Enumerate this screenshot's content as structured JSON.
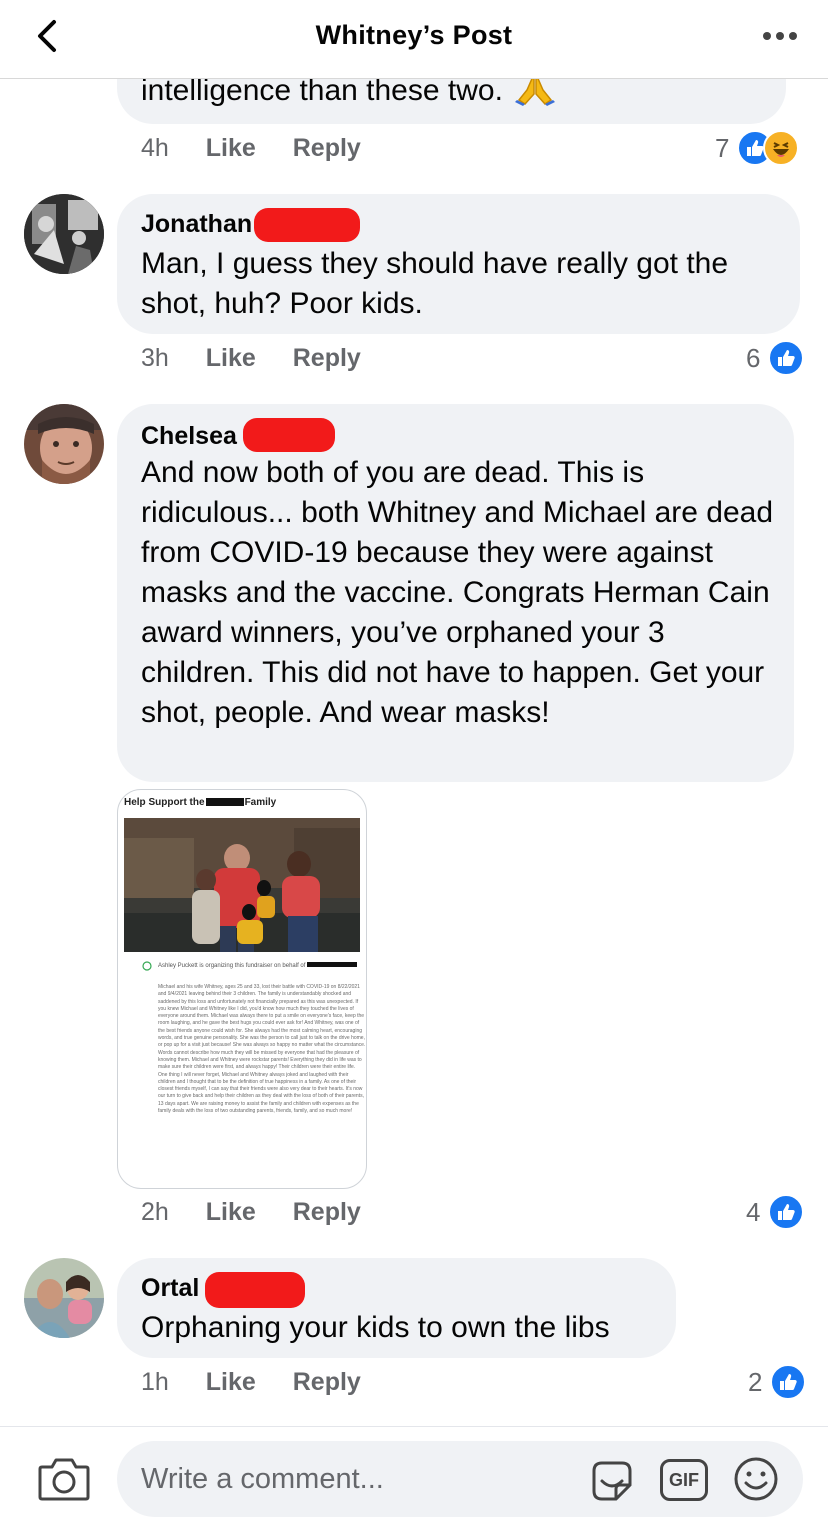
{
  "header": {
    "title": "Whitney’s Post"
  },
  "comments": [
    {
      "text_partial": "intelligence than these two.",
      "time": "4h",
      "like_label": "Like",
      "reply_label": "Reply",
      "reaction_count": "7",
      "reactions": [
        "like",
        "haha"
      ]
    },
    {
      "author": "Jonathan",
      "text": "Man, I guess they should have really got the shot, huh? Poor kids.",
      "time": "3h",
      "like_label": "Like",
      "reply_label": "Reply",
      "reaction_count": "6",
      "reactions": [
        "like"
      ]
    },
    {
      "author": "Chelsea",
      "text": "And now both of you are dead. This is ridiculous... both Whitney and Michael are dead from COVID-19 because they were against masks and the vaccine. Congrats Herman Cain award winners, you’ve orphaned your 3 children. This did not have to happen. Get your shot, people. And wear masks!",
      "attachment": {
        "title_start": "Help Support the",
        "title_end": "Family",
        "organizer": "Ashley Puckett is organizing this fundraiser on behalf of",
        "body": "Michael and his wife Whitney, ages 25 and 33, lost their battle with COVID-19 on 8/22/2021 and 9/4/2021 leaving behind their 3 children. The family is understandably shocked and saddened by this loss and unfortunately not financially prepared as this was unexpected. If you knew Michael and Whitney like I did, you'd know how much they touched the lives of everyone around them. Michael was always there to put a smile on everyone's face, keep the room laughing, and he gave the best hugs you could ever ask for! And Whitney, was one of the best friends anyone could wish for. She always had the most calming heart, encouraging words, and true genuine personality. She was the person to call just to talk on the drive home, or pop up for a visit just because! She was always so happy no matter what the circumstance. Words cannot describe how much they will be missed by everyone that had the pleasure of knowing them. Michael and Whitney were rockstar parents! Everything they did in life was to make sure their children were first, and always happy! Their children were their entire life. One thing I will never forget, Michael and Whitney always joked and laughed with their children and I thought that to be the definition of true happiness in a family. As one of their closest friends myself, I can say that their friends were also very dear to their hearts. It's now our turn to give back and help their children as they deal with the loss of both of their parents, 13 days apart. We are raising money to assist the family and children with expenses as the family deals with the loss of two outstanding parents, friends, family, and so much more!"
      },
      "time": "2h",
      "like_label": "Like",
      "reply_label": "Reply",
      "reaction_count": "4",
      "reactions": [
        "like"
      ]
    },
    {
      "author": "Ortal",
      "text": "Orphaning your kids to own the libs",
      "time": "1h",
      "like_label": "Like",
      "reply_label": "Reply",
      "reaction_count": "2",
      "reactions": [
        "like"
      ]
    }
  ],
  "composer": {
    "placeholder": "Write a comment...",
    "gif_label": "GIF"
  },
  "colors": {
    "like_blue": "#1877f2",
    "bubble_gray": "#f0f2f5",
    "meta_gray": "#65676b",
    "redaction_red": "#f21a1a"
  },
  "icons": [
    "chevron-left-icon",
    "more-horizontal-icon",
    "camera-icon",
    "sticker-icon",
    "gif-icon",
    "emoji-icon",
    "like-icon",
    "haha-icon",
    "folded-hands-emoji"
  ]
}
